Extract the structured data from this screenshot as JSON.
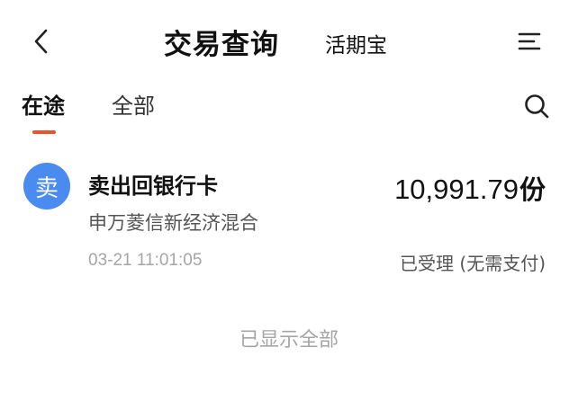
{
  "header": {
    "back_icon": "chevron-left-icon",
    "title": "交易查询",
    "subtitle": "活期宝",
    "menu_icon": "menu-lines-icon"
  },
  "tabs": [
    {
      "label": "在途",
      "active": true
    },
    {
      "label": "全部",
      "active": false
    }
  ],
  "tab_indicator_color": "#e8542e",
  "search_icon": "search-icon",
  "records": [
    {
      "badge": "卖",
      "badge_color": "#4a8bf0",
      "title": "卖出回银行卡",
      "amount": "10,991.79",
      "unit": "份",
      "fund_name": "申万菱信新经济混合",
      "time": "03-21 11:01:05",
      "status": "已受理 (无需支付)"
    }
  ],
  "footer_note": "已显示全部"
}
